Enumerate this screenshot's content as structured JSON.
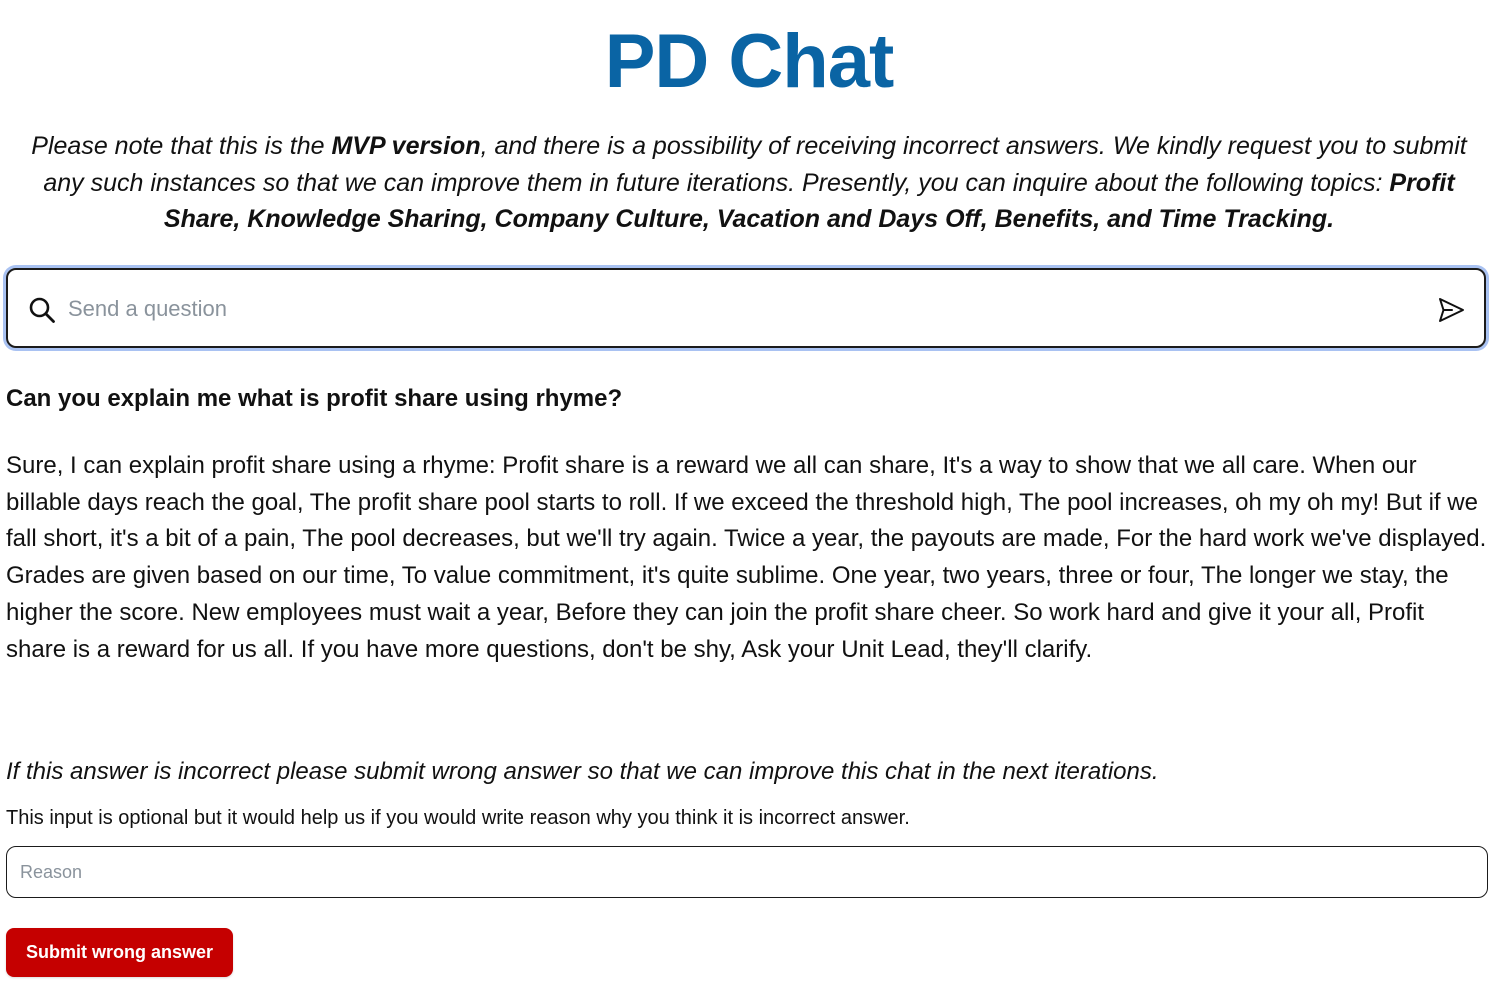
{
  "app": {
    "title": "PD Chat"
  },
  "notice": {
    "part1": "Please note that this is the ",
    "bold1": "MVP version",
    "part2": ", and there is a possibility of receiving incorrect answers. We kindly request you to submit any such instances so that we can improve them in future iterations. Presently, you can inquire about the following topics: ",
    "topics": "Profit Share, Knowledge Sharing, Company Culture, Vacation and Days Off, Benefits, and Time Tracking."
  },
  "search": {
    "placeholder": "Send a question",
    "value": ""
  },
  "conversation": {
    "question": "Can you explain me what is profit share using rhyme?",
    "answer": "Sure, I can explain profit share using a rhyme: Profit share is a reward we all can share, It's a way to show that we all care. When our billable days reach the goal, The profit share pool starts to roll. If we exceed the threshold high, The pool increases, oh my oh my! But if we fall short, it's a bit of a pain, The pool decreases, but we'll try again. Twice a year, the payouts are made, For the hard work we've displayed. Grades are given based on our time, To value commitment, it's quite sublime. One year, two years, three or four, The longer we stay, the higher the score. New employees must wait a year, Before they can join the profit share cheer. So work hard and give it your all, Profit share is a reward for us all. If you have more questions, don't be shy, Ask your Unit Lead, they'll clarify."
  },
  "feedback": {
    "prompt": "If this answer is incorrect please submit wrong answer so that we can improve this chat in the next iterations.",
    "help": "This input is optional but it would help us if you would write reason why you think it is incorrect answer.",
    "reason_placeholder": "Reason",
    "reason_value": "",
    "submit_label": "Submit wrong answer"
  },
  "icons": {
    "search": "search-icon",
    "send": "send-icon"
  },
  "colors": {
    "title": "#0a64a4",
    "focus_ring": "#a9c2f2",
    "submit_bg": "#c50000"
  }
}
